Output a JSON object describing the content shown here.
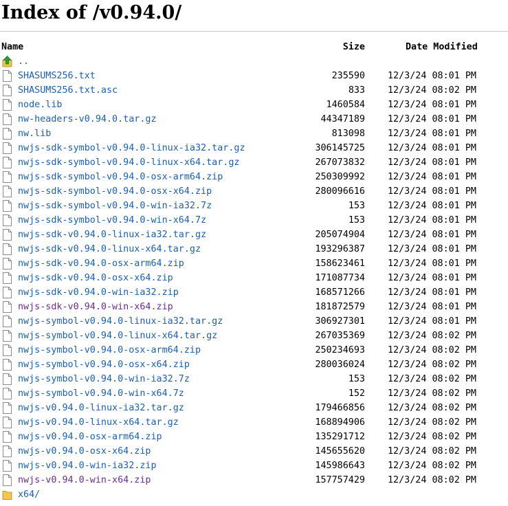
{
  "page": {
    "title": "Index of /v0.94.0/"
  },
  "columns": {
    "name": "Name",
    "size": "Size",
    "date": "Date Modified"
  },
  "parent": {
    "label": "..",
    "icon": "parent-directory-arrow-icon"
  },
  "files": [
    {
      "name": "SHASUMS256.txt",
      "size": "235590",
      "date": "12/3/24 08:01 PM",
      "icon": "file-icon",
      "visited": false
    },
    {
      "name": "SHASUMS256.txt.asc",
      "size": "833",
      "date": "12/3/24 08:02 PM",
      "icon": "file-icon",
      "visited": false
    },
    {
      "name": "node.lib",
      "size": "1460584",
      "date": "12/3/24 08:01 PM",
      "icon": "file-icon",
      "visited": false
    },
    {
      "name": "nw-headers-v0.94.0.tar.gz",
      "size": "44347189",
      "date": "12/3/24 08:01 PM",
      "icon": "file-icon",
      "visited": false
    },
    {
      "name": "nw.lib",
      "size": "813098",
      "date": "12/3/24 08:01 PM",
      "icon": "file-icon",
      "visited": false
    },
    {
      "name": "nwjs-sdk-symbol-v0.94.0-linux-ia32.tar.gz",
      "size": "306145725",
      "date": "12/3/24 08:01 PM",
      "icon": "file-icon",
      "visited": false
    },
    {
      "name": "nwjs-sdk-symbol-v0.94.0-linux-x64.tar.gz",
      "size": "267073832",
      "date": "12/3/24 08:01 PM",
      "icon": "file-icon",
      "visited": false
    },
    {
      "name": "nwjs-sdk-symbol-v0.94.0-osx-arm64.zip",
      "size": "250309992",
      "date": "12/3/24 08:01 PM",
      "icon": "file-icon",
      "visited": false
    },
    {
      "name": "nwjs-sdk-symbol-v0.94.0-osx-x64.zip",
      "size": "280096616",
      "date": "12/3/24 08:01 PM",
      "icon": "file-icon",
      "visited": false
    },
    {
      "name": "nwjs-sdk-symbol-v0.94.0-win-ia32.7z",
      "size": "153",
      "date": "12/3/24 08:01 PM",
      "icon": "file-icon",
      "visited": false
    },
    {
      "name": "nwjs-sdk-symbol-v0.94.0-win-x64.7z",
      "size": "153",
      "date": "12/3/24 08:01 PM",
      "icon": "file-icon",
      "visited": false
    },
    {
      "name": "nwjs-sdk-v0.94.0-linux-ia32.tar.gz",
      "size": "205074904",
      "date": "12/3/24 08:01 PM",
      "icon": "file-icon",
      "visited": false
    },
    {
      "name": "nwjs-sdk-v0.94.0-linux-x64.tar.gz",
      "size": "193296387",
      "date": "12/3/24 08:01 PM",
      "icon": "file-icon",
      "visited": false
    },
    {
      "name": "nwjs-sdk-v0.94.0-osx-arm64.zip",
      "size": "158623461",
      "date": "12/3/24 08:01 PM",
      "icon": "file-icon",
      "visited": false
    },
    {
      "name": "nwjs-sdk-v0.94.0-osx-x64.zip",
      "size": "171087734",
      "date": "12/3/24 08:01 PM",
      "icon": "file-icon",
      "visited": false
    },
    {
      "name": "nwjs-sdk-v0.94.0-win-ia32.zip",
      "size": "168571266",
      "date": "12/3/24 08:01 PM",
      "icon": "file-icon",
      "visited": false
    },
    {
      "name": "nwjs-sdk-v0.94.0-win-x64.zip",
      "size": "181872579",
      "date": "12/3/24 08:01 PM",
      "icon": "file-icon",
      "visited": true
    },
    {
      "name": "nwjs-symbol-v0.94.0-linux-ia32.tar.gz",
      "size": "306927301",
      "date": "12/3/24 08:01 PM",
      "icon": "file-icon",
      "visited": false
    },
    {
      "name": "nwjs-symbol-v0.94.0-linux-x64.tar.gz",
      "size": "267035369",
      "date": "12/3/24 08:02 PM",
      "icon": "file-icon",
      "visited": false
    },
    {
      "name": "nwjs-symbol-v0.94.0-osx-arm64.zip",
      "size": "250234693",
      "date": "12/3/24 08:02 PM",
      "icon": "file-icon",
      "visited": false
    },
    {
      "name": "nwjs-symbol-v0.94.0-osx-x64.zip",
      "size": "280036024",
      "date": "12/3/24 08:02 PM",
      "icon": "file-icon",
      "visited": false
    },
    {
      "name": "nwjs-symbol-v0.94.0-win-ia32.7z",
      "size": "153",
      "date": "12/3/24 08:02 PM",
      "icon": "file-icon",
      "visited": false
    },
    {
      "name": "nwjs-symbol-v0.94.0-win-x64.7z",
      "size": "152",
      "date": "12/3/24 08:02 PM",
      "icon": "file-icon",
      "visited": false
    },
    {
      "name": "nwjs-v0.94.0-linux-ia32.tar.gz",
      "size": "179466856",
      "date": "12/3/24 08:02 PM",
      "icon": "file-icon",
      "visited": false
    },
    {
      "name": "nwjs-v0.94.0-linux-x64.tar.gz",
      "size": "168894906",
      "date": "12/3/24 08:02 PM",
      "icon": "file-icon",
      "visited": false
    },
    {
      "name": "nwjs-v0.94.0-osx-arm64.zip",
      "size": "135291712",
      "date": "12/3/24 08:02 PM",
      "icon": "file-icon",
      "visited": false
    },
    {
      "name": "nwjs-v0.94.0-osx-x64.zip",
      "size": "145655620",
      "date": "12/3/24 08:02 PM",
      "icon": "file-icon",
      "visited": false
    },
    {
      "name": "nwjs-v0.94.0-win-ia32.zip",
      "size": "145986643",
      "date": "12/3/24 08:02 PM",
      "icon": "file-icon",
      "visited": false
    },
    {
      "name": "nwjs-v0.94.0-win-x64.zip",
      "size": "157757429",
      "date": "12/3/24 08:02 PM",
      "icon": "file-icon",
      "visited": true
    }
  ],
  "directories": [
    {
      "name": "x64/",
      "icon": "folder-icon"
    }
  ],
  "colors": {
    "link": "#1a5fb4",
    "visited": "#6b2d8f",
    "rule": "#c8c8c8"
  }
}
